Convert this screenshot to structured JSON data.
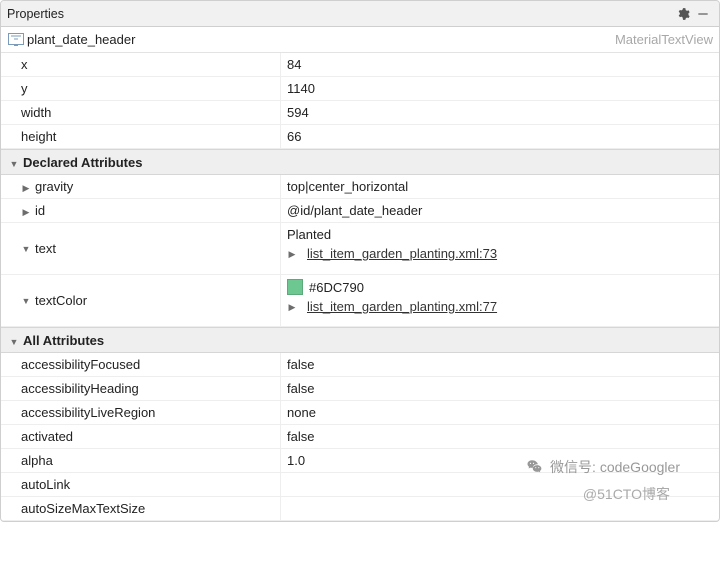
{
  "panel": {
    "title": "Properties"
  },
  "element": {
    "name": "plant_date_header",
    "class": "MaterialTextView"
  },
  "basic": {
    "x": {
      "label": "x",
      "value": "84"
    },
    "y": {
      "label": "y",
      "value": "1140"
    },
    "width": {
      "label": "width",
      "value": "594"
    },
    "height": {
      "label": "height",
      "value": "66"
    }
  },
  "sections": {
    "declared_label": "Declared Attributes",
    "all_label": "All Attributes"
  },
  "declared": {
    "gravity": {
      "label": "gravity",
      "value": "top|center_horizontal"
    },
    "id": {
      "label": "id",
      "value": "@id/plant_date_header"
    },
    "text": {
      "label": "text",
      "value": "Planted",
      "ref": "list_item_garden_planting.xml:73"
    },
    "textColor": {
      "label": "textColor",
      "value": "#6DC790",
      "ref": "list_item_garden_planting.xml:77"
    }
  },
  "all": {
    "accessibilityFocused": {
      "label": "accessibilityFocused",
      "value": "false"
    },
    "accessibilityHeading": {
      "label": "accessibilityHeading",
      "value": "false"
    },
    "accessibilityLiveRegion": {
      "label": "accessibilityLiveRegion",
      "value": "none"
    },
    "activated": {
      "label": "activated",
      "value": "false"
    },
    "alpha": {
      "label": "alpha",
      "value": "1.0"
    },
    "autoLink": {
      "label": "autoLink",
      "value": ""
    },
    "autoSizeMaxTextSize": {
      "label": "autoSizeMaxTextSize",
      "value": ""
    }
  },
  "watermark": {
    "line1": "微信号: codeGoogler",
    "line2": "@51CTO博客"
  }
}
